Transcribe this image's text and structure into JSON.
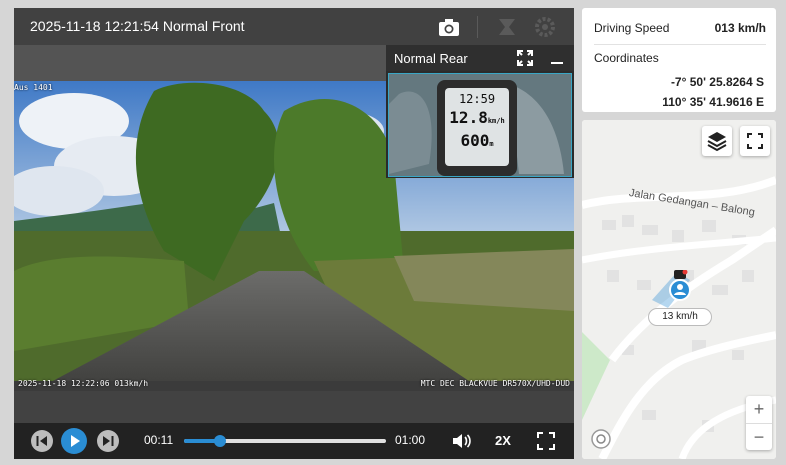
{
  "player": {
    "title": "2025-11-18 12:21:54 Normal Front",
    "icons": {
      "snapshot": "camera-icon",
      "share": "share-icon",
      "settings": "gear-icon"
    },
    "front_osd": {
      "top_left": "Aus 1401",
      "bottom_left": "2025-11-18 12:22:06 013km/h",
      "bottom_right": "MTC DEC BLACKVUE DR570X/UHD-DUD"
    },
    "rear": {
      "label": "Normal Rear",
      "meter": {
        "time": "12:59",
        "speed": "12.8",
        "speed_unit": "km/h",
        "distance": "600",
        "distance_unit": "m"
      }
    },
    "controls": {
      "current_time": "00:11",
      "total_time": "01:00",
      "progress": 0.18,
      "speed": "2X"
    }
  },
  "info": {
    "speed_label": "Driving Speed",
    "speed_value": "013 km/h",
    "coord_label": "Coordinates",
    "lat": "-7° 50' 25.8264 S",
    "lon": "110° 35' 41.9616 E"
  },
  "map": {
    "road_label": "Jalan Gedangan – Balong",
    "speed_tag": "13 km/h",
    "zoom_in": "+",
    "zoom_out": "−",
    "colors": {
      "marker": "#2a8dd4",
      "park": "#cde9c9",
      "road": "#ffffff"
    }
  }
}
